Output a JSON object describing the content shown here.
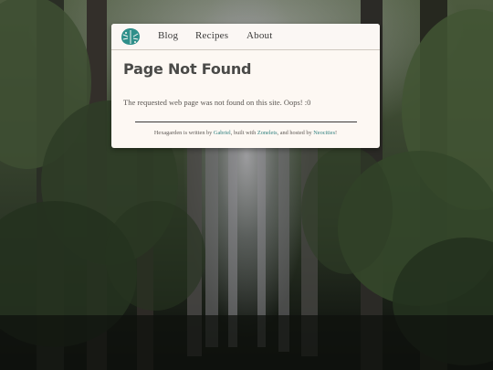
{
  "nav": {
    "logo_icon": "monstera-leaf-icon",
    "links": [
      {
        "label": "Blog"
      },
      {
        "label": "Recipes"
      },
      {
        "label": "About"
      }
    ]
  },
  "page": {
    "title": "Page Not Found",
    "message": "The requested web page was not found on this site. Oops! :0"
  },
  "footer": {
    "text_1": "Hexagarden is written by ",
    "link_author": "Gabriel",
    "text_2": ", built with ",
    "link_engine": "Zonelets",
    "text_3": ", and hosted by ",
    "link_host": "Neocities",
    "text_4": "!"
  },
  "colors": {
    "accent": "#2f7f7e",
    "card_background": "#fdf8f3",
    "forest_dark": "#161b14"
  }
}
